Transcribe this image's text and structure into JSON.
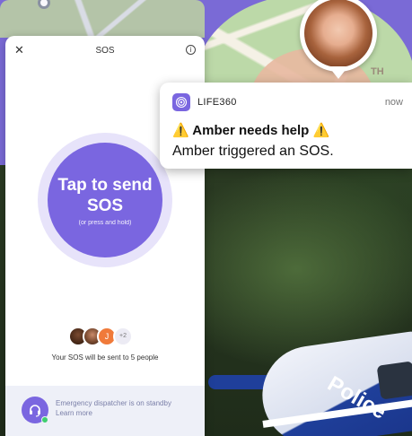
{
  "sos_panel": {
    "title": "SOS",
    "close_icon": "✕",
    "info_icon": "i",
    "sos_button_label": "Tap to send SOS",
    "sos_button_hint": "(or press and hold)",
    "contacts": {
      "avatar3_initial": "J",
      "more_count": "+2"
    },
    "recipients_text": "Your SOS will be sent to 5 people",
    "dispatcher_text": "Emergency dispatcher is on standby",
    "learn_more": "Learn more"
  },
  "notification": {
    "app_name": "LIFE360",
    "time": "now",
    "title": "⚠️ Amber needs help ⚠️",
    "body": "Amber triggered an SOS."
  },
  "background": {
    "map_label": "TH",
    "vehicle_text": "Police"
  },
  "colors": {
    "accent": "#7a66e0",
    "accent_light": "#e7e3fa",
    "online": "#3ecf6e"
  },
  "icons": [
    "close-icon",
    "info-icon",
    "headset-icon",
    "life360-icon"
  ]
}
